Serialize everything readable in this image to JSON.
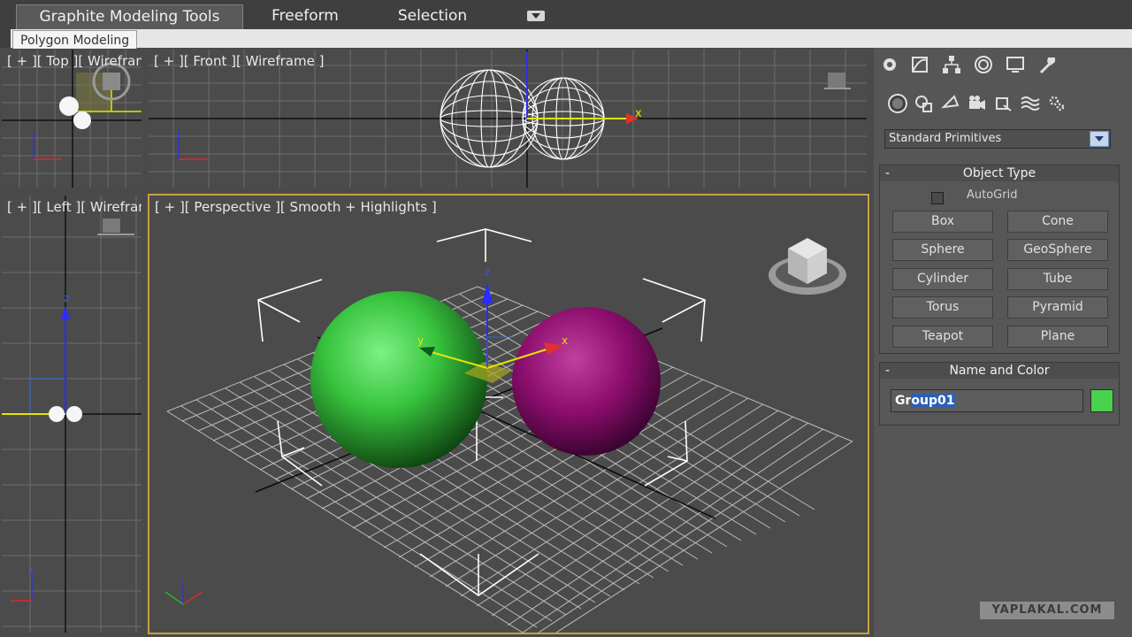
{
  "ribbon": {
    "tabs": [
      "Graphite Modeling Tools",
      "Freeform",
      "Selection"
    ],
    "subtab": "Polygon Modeling"
  },
  "viewports": {
    "top": "[ + ][ Top ][ Wireframe ]",
    "front": "[ + ][ Front ][ Wireframe ]",
    "left": "[ + ][ Left ][ Wireframe ]",
    "perspective": "[ + ][ Perspective ][ Smooth + Highlights ]"
  },
  "axis_labels": {
    "x": "x",
    "y": "y",
    "z": "z"
  },
  "command_panel": {
    "tab_icons": [
      "create-icon",
      "modify-icon",
      "hierarchy-icon",
      "motion-icon",
      "display-icon",
      "utilities-icon"
    ],
    "category_icons": [
      "geometry-icon",
      "shapes-icon",
      "lights-icon",
      "cameras-icon",
      "helpers-icon",
      "spacewarps-icon",
      "systems-icon"
    ],
    "dropdown_value": "Standard Primitives",
    "object_type": {
      "title": "Object Type",
      "autogrid": "AutoGrid",
      "buttons": [
        "Box",
        "Cone",
        "Sphere",
        "GeoSphere",
        "Cylinder",
        "Tube",
        "Torus",
        "Pyramid",
        "Teapot",
        "Plane"
      ]
    },
    "name_and_color": {
      "title": "Name and Color",
      "name_prefix": "Gr",
      "name_selected": "oup01",
      "color": "#48d24e"
    },
    "rollout_minus": "-"
  },
  "colors": {
    "green_sphere": "#3ed84a",
    "purple_sphere": "#a0107a",
    "active_border": "#c8a046"
  },
  "watermark": "YAPLAKAL.COM"
}
